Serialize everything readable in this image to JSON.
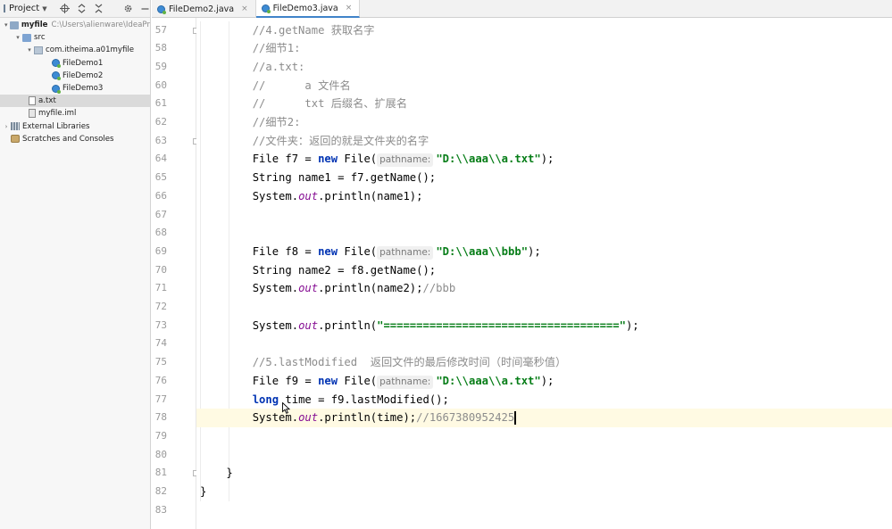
{
  "project_panel": {
    "toolbar_title": "Project",
    "tree": [
      {
        "label": "myfile",
        "path_hint": "C:\\Users\\alienware\\IdeaPr",
        "icon": "folder-icon",
        "level": 0,
        "arrow": "▾",
        "bold": true
      },
      {
        "label": "src",
        "icon": "source-folder-icon",
        "level": 1,
        "arrow": "▾"
      },
      {
        "label": "com.itheima.a01myfile",
        "icon": "package-icon",
        "level": 2,
        "arrow": "▾"
      },
      {
        "label": "FileDemo1",
        "icon": "java-class-icon",
        "level": 3,
        "arrow": ""
      },
      {
        "label": "FileDemo2",
        "icon": "java-class-icon",
        "level": 3,
        "arrow": ""
      },
      {
        "label": "FileDemo3",
        "icon": "java-class-icon",
        "level": 3,
        "arrow": ""
      },
      {
        "label": "a.txt",
        "icon": "text-file-icon",
        "level": 1,
        "arrow": "",
        "selected": true
      },
      {
        "label": "myfile.iml",
        "icon": "iml-file-icon",
        "level": 1,
        "arrow": ""
      },
      {
        "label": "External Libraries",
        "icon": "library-icon",
        "level": 0,
        "arrow": "›"
      },
      {
        "label": "Scratches and Consoles",
        "icon": "scratch-icon",
        "level": 0,
        "arrow": ""
      }
    ]
  },
  "tabs": [
    {
      "label": "FileDemo2.java",
      "active": false
    },
    {
      "label": "FileDemo3.java",
      "active": true
    }
  ],
  "editor": {
    "current_line": 78,
    "lines": [
      {
        "no": "57",
        "tokens": [
          {
            "t": "        //4.getName 获取名字",
            "c": "comment"
          }
        ]
      },
      {
        "no": "58",
        "tokens": [
          {
            "t": "        //细节1:",
            "c": "comment"
          }
        ]
      },
      {
        "no": "59",
        "tokens": [
          {
            "t": "        //a.txt:",
            "c": "comment"
          }
        ]
      },
      {
        "no": "60",
        "tokens": [
          {
            "t": "        //      a 文件名",
            "c": "comment"
          }
        ]
      },
      {
        "no": "61",
        "tokens": [
          {
            "t": "        //      txt 后缀名、扩展名",
            "c": "comment"
          }
        ]
      },
      {
        "no": "62",
        "tokens": [
          {
            "t": "        //细节2:",
            "c": "comment"
          }
        ]
      },
      {
        "no": "63",
        "tokens": [
          {
            "t": "        //文件夹：返回的就是文件夹的名字",
            "c": "comment"
          }
        ]
      },
      {
        "no": "64",
        "tokens": [
          {
            "t": "        File f7 = ",
            "c": "plain"
          },
          {
            "t": "new",
            "c": "keyword"
          },
          {
            "t": " File(",
            "c": "plain"
          },
          {
            "t": "pathname:",
            "c": "hint"
          },
          {
            "t": "\"D:\\\\aaa\\\\a.txt\"",
            "c": "string"
          },
          {
            "t": ");",
            "c": "plain"
          }
        ]
      },
      {
        "no": "65",
        "tokens": [
          {
            "t": "        String name1 = f7.getName();",
            "c": "plain"
          }
        ]
      },
      {
        "no": "66",
        "tokens": [
          {
            "t": "        System.",
            "c": "plain"
          },
          {
            "t": "out",
            "c": "static"
          },
          {
            "t": ".println(name1);",
            "c": "plain"
          }
        ]
      },
      {
        "no": "67",
        "tokens": []
      },
      {
        "no": "68",
        "tokens": []
      },
      {
        "no": "69",
        "tokens": [
          {
            "t": "        File f8 = ",
            "c": "plain"
          },
          {
            "t": "new",
            "c": "keyword"
          },
          {
            "t": " File(",
            "c": "plain"
          },
          {
            "t": "pathname:",
            "c": "hint"
          },
          {
            "t": "\"D:\\\\aaa\\\\bbb\"",
            "c": "string"
          },
          {
            "t": ");",
            "c": "plain"
          }
        ]
      },
      {
        "no": "70",
        "tokens": [
          {
            "t": "        String name2 = f8.getName();",
            "c": "plain"
          }
        ]
      },
      {
        "no": "71",
        "tokens": [
          {
            "t": "        System.",
            "c": "plain"
          },
          {
            "t": "out",
            "c": "static"
          },
          {
            "t": ".println(name2);",
            "c": "plain"
          },
          {
            "t": "//bbb",
            "c": "comment"
          }
        ]
      },
      {
        "no": "72",
        "tokens": []
      },
      {
        "no": "73",
        "tokens": [
          {
            "t": "        System.",
            "c": "plain"
          },
          {
            "t": "out",
            "c": "static"
          },
          {
            "t": ".println(",
            "c": "plain"
          },
          {
            "t": "\"====================================\"",
            "c": "string"
          },
          {
            "t": ");",
            "c": "plain"
          }
        ]
      },
      {
        "no": "74",
        "tokens": []
      },
      {
        "no": "75",
        "tokens": [
          {
            "t": "        //5.lastModified  返回文件的最后修改时间（时间毫秒值）",
            "c": "comment"
          }
        ]
      },
      {
        "no": "76",
        "tokens": [
          {
            "t": "        File f9 = ",
            "c": "plain"
          },
          {
            "t": "new",
            "c": "keyword"
          },
          {
            "t": " File(",
            "c": "plain"
          },
          {
            "t": "pathname:",
            "c": "hint"
          },
          {
            "t": "\"D:\\\\aaa\\\\a.txt\"",
            "c": "string"
          },
          {
            "t": ");",
            "c": "plain"
          }
        ]
      },
      {
        "no": "77",
        "tokens": [
          {
            "t": "        ",
            "c": "plain"
          },
          {
            "t": "long",
            "c": "keyword"
          },
          {
            "t": " time = f9.lastModified();",
            "c": "plain"
          }
        ]
      },
      {
        "no": "78",
        "tokens": [
          {
            "t": "        System.",
            "c": "plain"
          },
          {
            "t": "out",
            "c": "static"
          },
          {
            "t": ".println(time);",
            "c": "plain"
          },
          {
            "t": "//1667380952425",
            "c": "comment"
          },
          {
            "t": "",
            "c": "caret"
          }
        ]
      },
      {
        "no": "79",
        "tokens": []
      },
      {
        "no": "80",
        "tokens": []
      },
      {
        "no": "81",
        "tokens": [
          {
            "t": "    }",
            "c": "plain"
          }
        ]
      },
      {
        "no": "82",
        "tokens": [
          {
            "t": "}",
            "c": "plain"
          }
        ]
      },
      {
        "no": "83",
        "tokens": []
      }
    ]
  }
}
